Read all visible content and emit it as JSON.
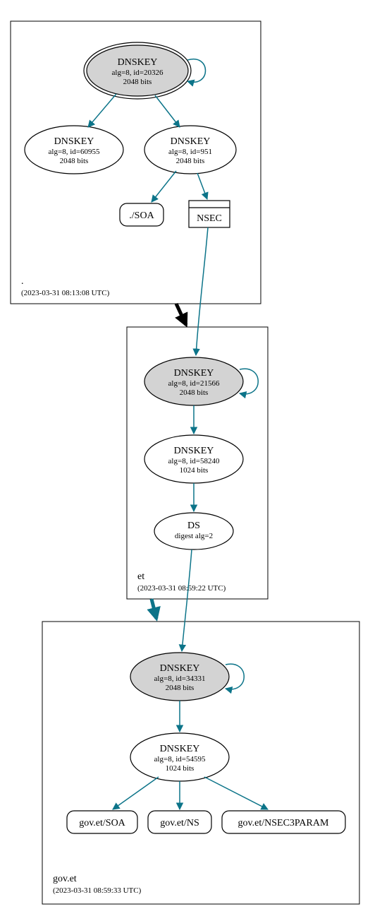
{
  "colors": {
    "edge": "#0c7489",
    "ksk_fill": "#d3d3d3"
  },
  "zones": [
    {
      "id": "root",
      "label": ".",
      "timestamp": "(2023-03-31 08:13:08 UTC)"
    },
    {
      "id": "et",
      "label": "et",
      "timestamp": "(2023-03-31 08:59:22 UTC)"
    },
    {
      "id": "gov-et",
      "label": "gov.et",
      "timestamp": "(2023-03-31 08:59:33 UTC)"
    }
  ],
  "nodes": {
    "root_ksk": {
      "title": "DNSKEY",
      "line2": "alg=8, id=20326",
      "line3": "2048 bits"
    },
    "root_zsk1": {
      "title": "DNSKEY",
      "line2": "alg=8, id=60955",
      "line3": "2048 bits"
    },
    "root_zsk2": {
      "title": "DNSKEY",
      "line2": "alg=8, id=951",
      "line3": "2048 bits"
    },
    "root_soa": {
      "title": "./SOA"
    },
    "root_nsec": {
      "title": "NSEC"
    },
    "et_ksk": {
      "title": "DNSKEY",
      "line2": "alg=8, id=21566",
      "line3": "2048 bits"
    },
    "et_zsk": {
      "title": "DNSKEY",
      "line2": "alg=8, id=58240",
      "line3": "1024 bits"
    },
    "et_ds": {
      "title": "DS",
      "line2": "digest alg=2"
    },
    "gov_ksk": {
      "title": "DNSKEY",
      "line2": "alg=8, id=34331",
      "line3": "2048 bits"
    },
    "gov_zsk": {
      "title": "DNSKEY",
      "line2": "alg=8, id=54595",
      "line3": "1024 bits"
    },
    "gov_soa": {
      "title": "gov.et/SOA"
    },
    "gov_ns": {
      "title": "gov.et/NS"
    },
    "gov_nsec3p": {
      "title": "gov.et/NSEC3PARAM"
    }
  }
}
